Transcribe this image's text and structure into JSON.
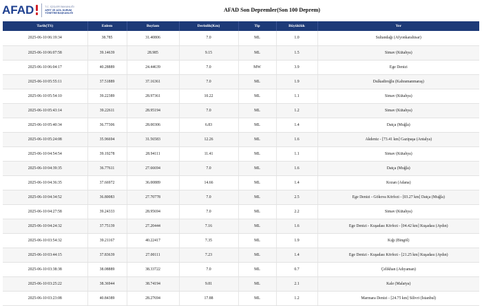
{
  "header": {
    "logo_word": "AFAD",
    "logo_sub_top": "T.C. İÇİŞLERİ BAKANLIĞI",
    "logo_sub_line1": "AFET VE ACİL DURUM",
    "logo_sub_line2": "YÖNETİMİ BAŞKANLIĞI",
    "title": "AFAD Son Depremler(Son 100 Deprem)"
  },
  "colors": {
    "brand_blue": "#1d3f8f",
    "table_header_bg": "#1d3a78",
    "logo_accent_red": "#d0202a"
  },
  "table": {
    "columns": [
      "Tarih(TS)",
      "Enlem",
      "Boylam",
      "Derinlik(Km)",
      "Tip",
      "Büyüklük",
      "Yer"
    ],
    "rows": [
      [
        "2025-06-10 06:19:34",
        "38.785",
        "31.40806",
        "7.0",
        "ML",
        "1.0",
        "Sultandağı (Afyonkarahisar)"
      ],
      [
        "2025-06-10 06:07:58",
        "39.14639",
        "28.985",
        "9.15",
        "ML",
        "1.5",
        "Simav (Kütahya)"
      ],
      [
        "2025-06-10 06:04:17",
        "40.28889",
        "24.44639",
        "7.0",
        "MW",
        "3.9",
        "Ege Denizi"
      ],
      [
        "2025-06-10 05:55:11",
        "37.51889",
        "37.16361",
        "7.0",
        "ML",
        "1.9",
        "Dulkadiroğlu (Kahramanmaraş)"
      ],
      [
        "2025-06-10 05:54:10",
        "39.22389",
        "28.97361",
        "10.22",
        "ML",
        "1.1",
        "Simav (Kütahya)"
      ],
      [
        "2025-06-10 05:43:14",
        "39.22611",
        "28.95194",
        "7.0",
        "ML",
        "1.2",
        "Simav (Kütahya)"
      ],
      [
        "2025-06-10 05:40:34",
        "36.77306",
        "28.00306",
        "6.83",
        "ML",
        "1.4",
        "Datça (Muğla)"
      ],
      [
        "2025-06-10 05:24:08",
        "35.96694",
        "31.56583",
        "12.26",
        "ML",
        "1.6",
        "Akdeniz - [73.41 km] Gazipaşa (Antalya)"
      ],
      [
        "2025-06-10 04:54:54",
        "39.19278",
        "28.94111",
        "11.41",
        "ML",
        "1.1",
        "Simav (Kütahya)"
      ],
      [
        "2025-06-10 04:39:35",
        "36.77611",
        "27.66694",
        "7.0",
        "ML",
        "1.6",
        "Datça (Muğla)"
      ],
      [
        "2025-06-10 04:36:35",
        "37.66972",
        "36.00889",
        "14.66",
        "ML",
        "1.4",
        "Kozan (Adana)"
      ],
      [
        "2025-06-10 04:34:52",
        "36.80083",
        "27.70778",
        "7.0",
        "ML",
        "2.5",
        "Ege Denizi - Gökova Körfezi - [03.27 km] Datça (Muğla)"
      ],
      [
        "2025-06-10 04:27:58",
        "39.24333",
        "28.95694",
        "7.0",
        "ML",
        "2.2",
        "Simav (Kütahya)"
      ],
      [
        "2025-06-10 04:24:32",
        "37.75139",
        "27.20444",
        "7.16",
        "ML",
        "1.6",
        "Ege Denizi - Kuşadası Körfezi - [04.42 km] Kuşadası (Aydın)"
      ],
      [
        "2025-06-10 03:54:32",
        "39.21167",
        "40.22417",
        "7.35",
        "ML",
        "1.9",
        "Kığı (Bingöl)"
      ],
      [
        "2025-06-10 03:44:15",
        "37.83639",
        "27.00111",
        "7.23",
        "ML",
        "1.4",
        "Ege Denizi - Kuşadası Körfezi - [21.25 km] Kuşadası (Aydın)"
      ],
      [
        "2025-06-10 03:38:38",
        "38.08889",
        "38.33722",
        "7.0",
        "ML",
        "0.7",
        "Çelikhan (Adıyaman)"
      ],
      [
        "2025-06-10 03:25:22",
        "38.36944",
        "38.74194",
        "9.81",
        "ML",
        "2.1",
        "Kale (Malatya)"
      ],
      [
        "2025-06-10 03:23:08",
        "40.84389",
        "28.27694",
        "17.88",
        "ML",
        "1.2",
        "Marmara Denizi - [24.75 km] Silivri (İstanbul)"
      ]
    ]
  }
}
